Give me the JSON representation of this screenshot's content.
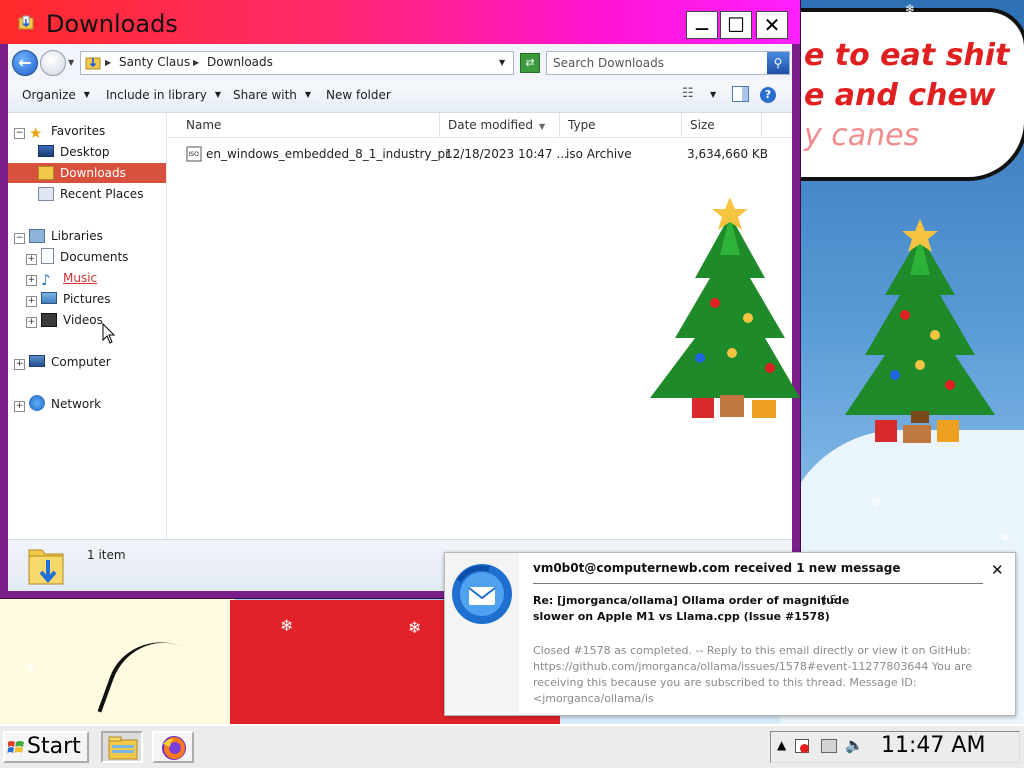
{
  "wallpaper": {
    "bubble_lines": [
      "e to eat shit",
      "e and chew",
      "y canes"
    ]
  },
  "window": {
    "title": "Downloads",
    "minimize_symbol": "—",
    "maximize_symbol": "☐",
    "close_symbol": "✕"
  },
  "address": {
    "crumbs": [
      "Santy Claus",
      "Downloads"
    ],
    "search_placeholder": "Search Downloads"
  },
  "toolbar": {
    "organize": "Organize",
    "include": "Include in library",
    "share": "Share with",
    "new_folder": "New folder"
  },
  "nav": {
    "favorites": "Favorites",
    "desktop": "Desktop",
    "downloads": "Downloads",
    "recent": "Recent Places",
    "libraries": "Libraries",
    "documents": "Documents",
    "music": "Music",
    "pictures": "Pictures",
    "videos": "Videos",
    "computer": "Computer",
    "network": "Network"
  },
  "columns": {
    "name": "Name",
    "date": "Date modified",
    "type": "Type",
    "size": "Size"
  },
  "files": [
    {
      "name": "en_windows_embedded_8_1_industry_pr...",
      "date": "12/18/2023 10:47 ...",
      "type": "iso Archive",
      "size": "3,634,660 KB"
    }
  ],
  "details": {
    "count": "1 item"
  },
  "taskbar": {
    "start": "Start",
    "clock": "11:47 AM"
  },
  "notification": {
    "heading": "vm0b0t@computernewb.com received 1 new message",
    "subject": "Re: [jmorganca/ollama] Ollama order of magnitude slower on Apple M1 vs Llama.cpp (Issue #1578)",
    "from": "J S",
    "body": "Closed #1578 as completed. -- Reply to this email directly or view it on GitHub: https://github.com/jmorganca/ollama/issues/1578#event-11277803644 You are receiving this because you are subscribed to this thread. Message ID: <jmorganca/ollama/is",
    "close_symbol": "✕"
  }
}
